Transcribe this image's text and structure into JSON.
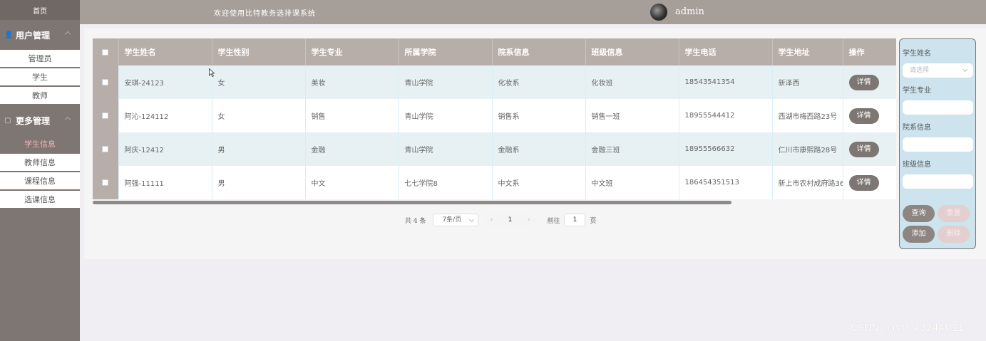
{
  "sidebar": {
    "home": "首页",
    "groups": [
      {
        "label": "用户管理",
        "items": [
          "管理员",
          "学生",
          "教师"
        ]
      },
      {
        "label": "更多管理",
        "items": [
          "学生信息",
          "教师信息",
          "课程信息",
          "选课信息"
        ],
        "active": "学生信息"
      }
    ]
  },
  "header": {
    "welcome": "欢迎使用比特教务选排课系统",
    "user": "admin"
  },
  "table": {
    "columns": [
      "学生姓名",
      "学生性别",
      "学生专业",
      "所属学院",
      "院系信息",
      "班级信息",
      "学生电话",
      "学生地址",
      "操作"
    ],
    "rows": [
      [
        "安琪-24123",
        "女",
        "美妆",
        "青山学院",
        "化妆系",
        "化妆班",
        "18543541354",
        "新泽西"
      ],
      [
        "阿沁-124112",
        "女",
        "销售",
        "青山学院",
        "销售系",
        "销售一班",
        "18955544412",
        "西湖市梅西路23号"
      ],
      [
        "阿庆-12412",
        "男",
        "金融",
        "青山学院",
        "金融系",
        "金融三班",
        "18955566632",
        "仁川市康熙路28号"
      ],
      [
        "阿强-11111",
        "男",
        "中文",
        "七七学院8",
        "中文系",
        "中文班",
        "186454351513",
        "新上市农村成府路36号"
      ]
    ],
    "detail_label": "详情"
  },
  "pager": {
    "total": "共 4 条",
    "size": "7条/页",
    "current": "1",
    "goto": "前往",
    "goto_value": "1",
    "page_suffix": "页"
  },
  "panel": {
    "name_label": "学生姓名",
    "name_placeholder": "请选择",
    "major_label": "学生专业",
    "dept_label": "院系信息",
    "class_label": "班级信息",
    "query": "查询",
    "reset": "重置",
    "add": "添加",
    "delete": "删除"
  },
  "watermark": "CSDN @m0_73244011"
}
